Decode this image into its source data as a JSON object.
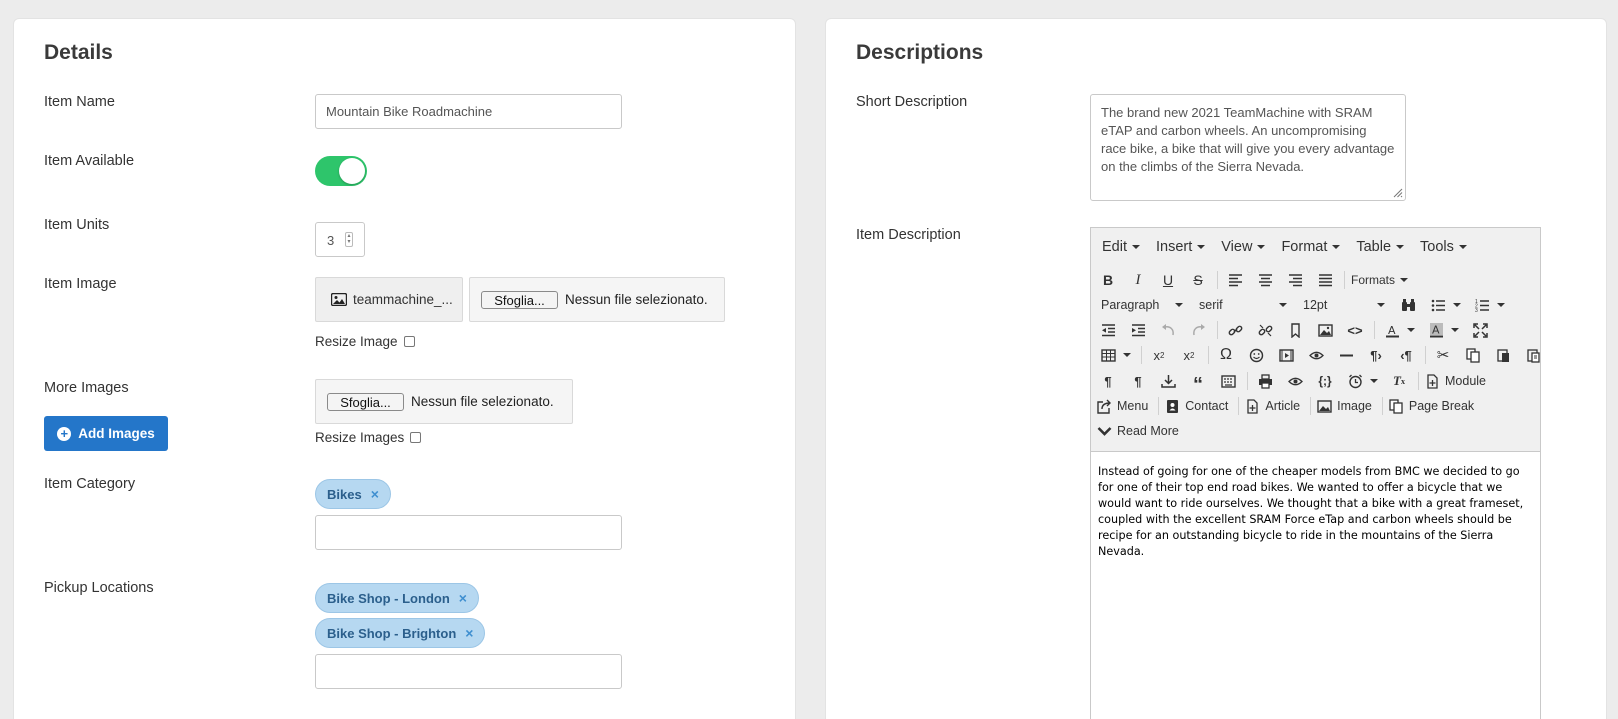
{
  "details": {
    "title": "Details",
    "item_name": {
      "label": "Item Name",
      "value": "Mountain Bike Roadmachine"
    },
    "item_available": {
      "label": "Item Available",
      "on": true
    },
    "item_units": {
      "label": "Item Units",
      "value": "3"
    },
    "item_image": {
      "label": "Item Image",
      "current_file": "teammachine_...",
      "browse_label": "Sfoglia...",
      "no_file_text": "Nessun file selezionato.",
      "resize_label": "Resize Image"
    },
    "more_images": {
      "label": "More Images",
      "add_button": "Add Images",
      "browse_label": "Sfoglia...",
      "no_file_text": "Nessun file selezionato.",
      "resize_label": "Resize Images"
    },
    "item_category": {
      "label": "Item Category",
      "tags": [
        "Bikes"
      ],
      "input_value": ""
    },
    "pickup_locations": {
      "label": "Pickup Locations",
      "tags": [
        "Bike Shop - London",
        "Bike Shop - Brighton"
      ],
      "input_value": ""
    }
  },
  "descriptions": {
    "title": "Descriptions",
    "short_description": {
      "label": "Short Description",
      "value": "The brand new 2021 TeamMachine with SRAM eTAP and carbon wheels. An uncompromising race bike, a bike that will give you every advantage on the climbs of the Sierra Nevada."
    },
    "item_description": {
      "label": "Item Description",
      "menus": [
        "Edit",
        "Insert",
        "View",
        "Format",
        "Table",
        "Tools"
      ],
      "formats_label": "Formats",
      "block_select": "Paragraph",
      "font_select": "serif",
      "size_select": "12pt",
      "text_buttons": {
        "module": "Module",
        "menu": "Menu",
        "contact": "Contact",
        "article": "Article",
        "image": "Image",
        "page_break": "Page Break",
        "read_more": "Read More"
      },
      "content": "Instead of going for one of the cheaper models from BMC we decided to go for one of their top end road bikes. We wanted to offer a bicycle that we would want to ride ourselves. We thought that a bike with a great frameset, coupled with the excellent SRAM Force eTap and carbon wheels should be recipe for an outstanding bicycle to ride in the mountains of the Sierra Nevada."
    }
  },
  "colors": {
    "toggle_on": "#2ec56b",
    "primary_button": "#2476c9",
    "tag_bg": "#b6d8f1"
  }
}
